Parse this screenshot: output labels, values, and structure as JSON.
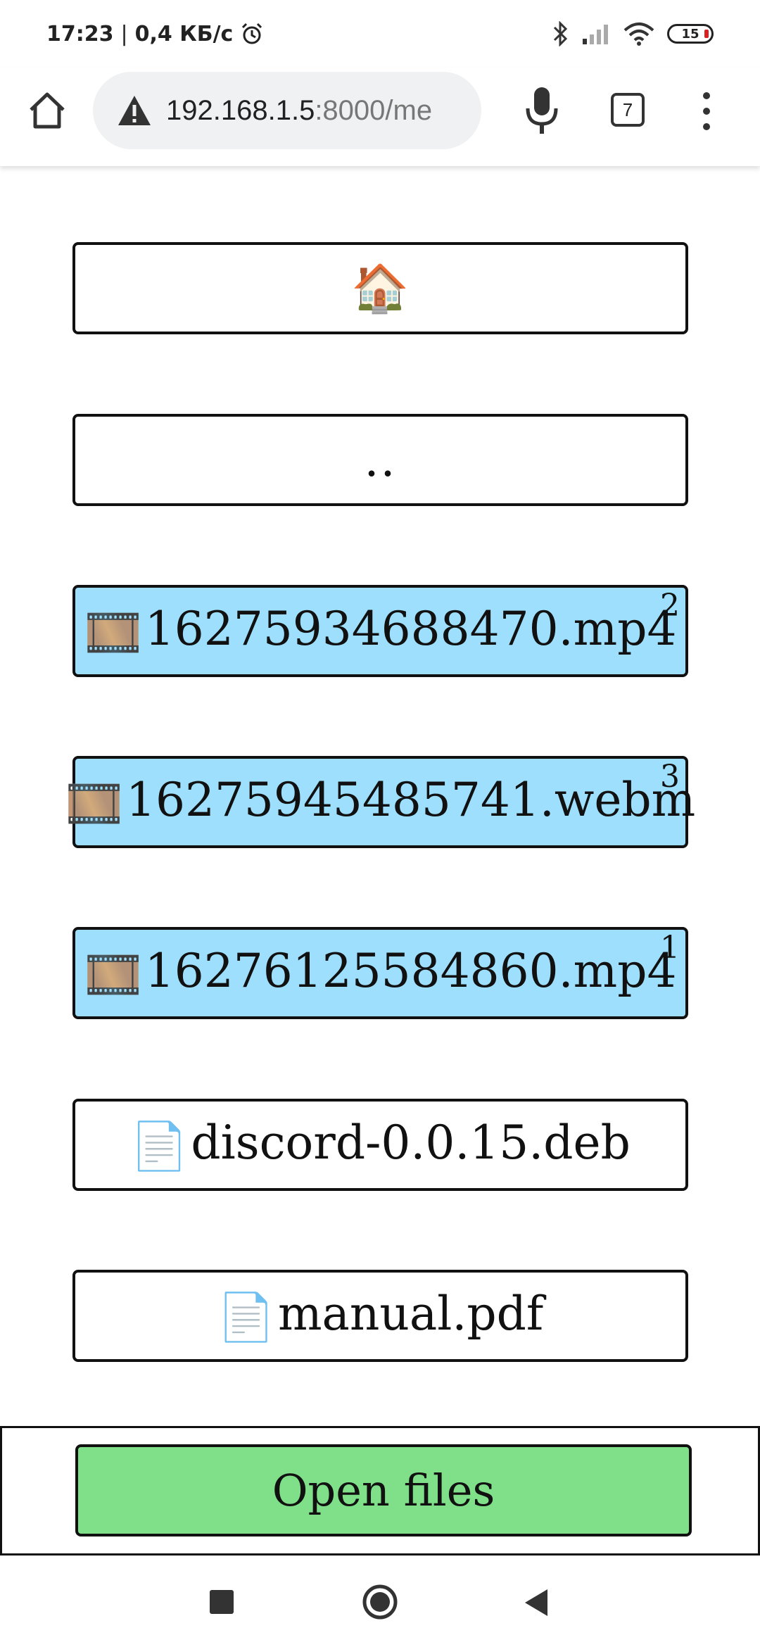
{
  "status_bar": {
    "time": "17:23",
    "separator": "|",
    "speed": "0,4 КБ/с",
    "battery_level": "15"
  },
  "toolbar": {
    "url_host": "192.168.1.5",
    "url_path": ":8000/me",
    "tab_count": "7"
  },
  "entries": [
    {
      "label": "🏠",
      "type": "home",
      "badge": ""
    },
    {
      "label": "..",
      "type": "parent",
      "badge": ""
    },
    {
      "icon": "🎞️",
      "label": "16275934688470.mp4",
      "type": "video",
      "badge": "2"
    },
    {
      "icon": "🎞️",
      "label": "16275945485741.webm",
      "type": "video",
      "badge": "3"
    },
    {
      "icon": "🎞️",
      "label": "16276125584860.mp4",
      "type": "video",
      "badge": "1"
    },
    {
      "icon": "📄",
      "label": "discord-0.0.15.deb",
      "type": "file",
      "badge": ""
    },
    {
      "icon": "📄",
      "label": "manual.pdf",
      "type": "file",
      "badge": ""
    }
  ],
  "open_files_label": "Open files",
  "colors": {
    "video_bg": "#9ddffc",
    "open_files_bg": "#80e08a",
    "battery_low": "#d82020"
  }
}
